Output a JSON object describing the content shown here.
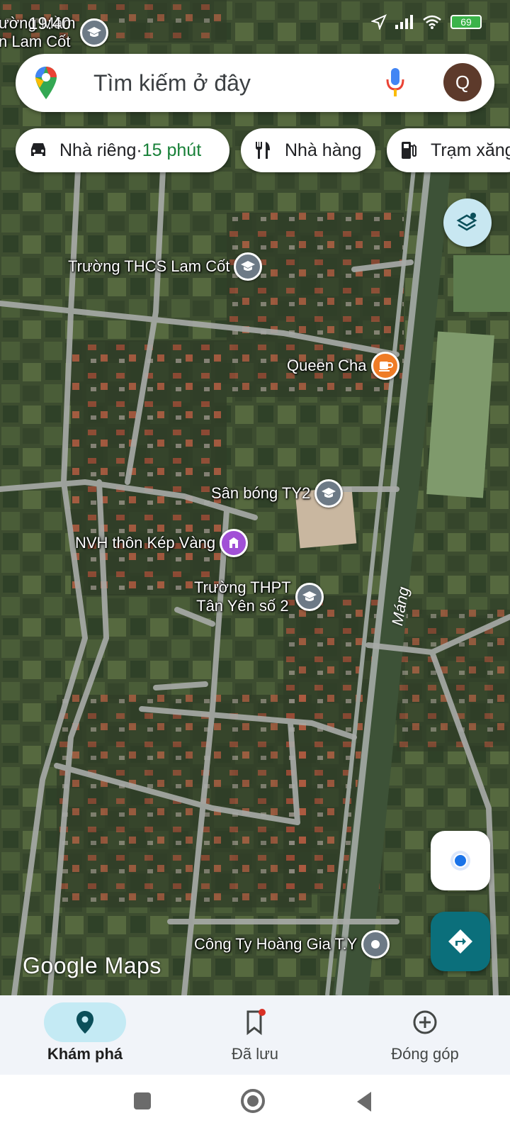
{
  "status_bar": {
    "time": "19:40",
    "battery": "69"
  },
  "search": {
    "placeholder": "Tìm kiếm ở đây",
    "avatar_letter": "Q"
  },
  "chips": [
    {
      "label": "Nhà riêng",
      "separator": " · ",
      "extra": "15 phút",
      "icon": "car-icon"
    },
    {
      "label": "Nhà hàng",
      "icon": "restaurant-icon"
    },
    {
      "label": "Trạm xăng",
      "icon": "gas-station-icon"
    }
  ],
  "map": {
    "top_left_label_1": "ường Mầm",
    "top_left_label_2": "n Lam Cốt",
    "road_label": "Máng",
    "pois": [
      {
        "name": "Trường THCS Lam Cốt",
        "type": "school"
      },
      {
        "name": "Queen Cha",
        "type": "cafe"
      },
      {
        "name": "Sân bóng TY2",
        "type": "school"
      },
      {
        "name": "NVH thôn Kép Vàng",
        "type": "venue"
      },
      {
        "name_line1": "Trường THPT",
        "name_line2": "Tân Yên số 2",
        "type": "school"
      },
      {
        "name": "Công Ty Hoàng Gia T.Y",
        "type": "generic"
      }
    ],
    "watermark": "Google Maps"
  },
  "bottom_nav": {
    "items": [
      {
        "label": "Khám phá",
        "icon": "location-pin-icon",
        "active": true
      },
      {
        "label": "Đã lưu",
        "icon": "bookmark-icon",
        "active": false
      },
      {
        "label": "Đóng góp",
        "icon": "add-circle-icon",
        "active": false
      }
    ]
  },
  "colors": {
    "accent_teal": "#0b6f7b",
    "active_pill": "#c4eaf4",
    "green_text": "#188038"
  }
}
